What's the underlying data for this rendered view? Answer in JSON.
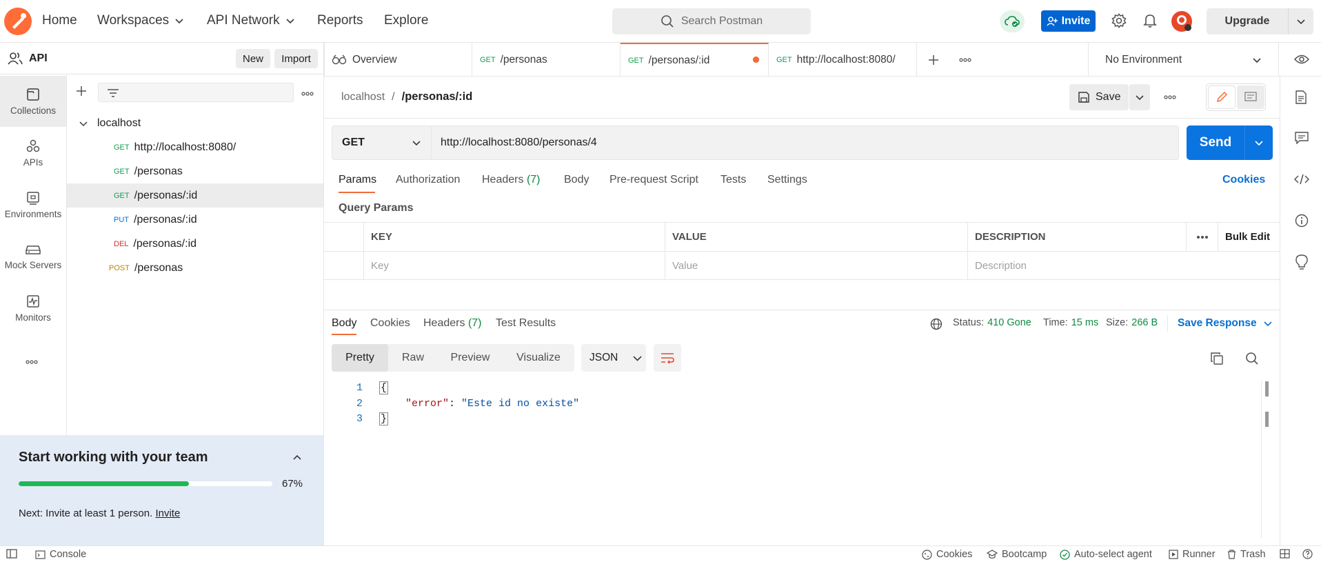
{
  "topnav": {
    "home": "Home",
    "workspaces": "Workspaces",
    "api_network": "API Network",
    "reports": "Reports",
    "explore": "Explore",
    "search_placeholder": "Search Postman",
    "invite": "Invite",
    "upgrade": "Upgrade"
  },
  "workspace": {
    "name": "API",
    "new_btn": "New",
    "import_btn": "Import"
  },
  "rail": [
    {
      "label": "Collections",
      "icon": "collections-icon"
    },
    {
      "label": "APIs",
      "icon": "apis-icon"
    },
    {
      "label": "Environments",
      "icon": "environments-icon"
    },
    {
      "label": "Mock Servers",
      "icon": "mock-servers-icon"
    },
    {
      "label": "Monitors",
      "icon": "monitors-icon"
    }
  ],
  "collection": {
    "name": "localhost",
    "items": [
      {
        "method": "GET",
        "path": "http://localhost:8080/"
      },
      {
        "method": "GET",
        "path": "/personas"
      },
      {
        "method": "GET",
        "path": "/personas/:id"
      },
      {
        "method": "PUT",
        "path": "/personas/:id"
      },
      {
        "method": "DEL",
        "path": "/personas/:id"
      },
      {
        "method": "POST",
        "path": "/personas"
      }
    ]
  },
  "team": {
    "title": "Start working with your team",
    "progress_pct": "67%",
    "progress_value": 0.67,
    "next_text": "Next: Invite at least 1 person.",
    "invite_link": "Invite"
  },
  "tabs": [
    {
      "label": "Overview"
    },
    {
      "method": "GET",
      "label": "/personas"
    },
    {
      "method": "GET",
      "label": "/personas/:id"
    },
    {
      "method": "GET",
      "label": "http://localhost:8080/"
    }
  ],
  "environment": "No Environment",
  "breadcrumb": {
    "parent": "localhost",
    "sep": "/",
    "current": "/personas/:id"
  },
  "save": "Save",
  "request": {
    "method": "GET",
    "url": "http://localhost:8080/personas/4",
    "send": "Send"
  },
  "req_tabs": {
    "params": "Params",
    "authorization": "Authorization",
    "headers": "Headers",
    "headers_count": "(7)",
    "body": "Body",
    "prerequest": "Pre-request Script",
    "tests": "Tests",
    "settings": "Settings",
    "cookies": "Cookies"
  },
  "query_params": {
    "title": "Query Params",
    "col_key": "KEY",
    "col_value": "VALUE",
    "col_description": "DESCRIPTION",
    "bulk_edit": "Bulk Edit",
    "ph_key": "Key",
    "ph_value": "Value",
    "ph_description": "Description"
  },
  "response": {
    "tabs": {
      "body": "Body",
      "cookies": "Cookies",
      "headers": "Headers",
      "headers_count": "(7)",
      "test_results": "Test Results"
    },
    "status_label": "Status:",
    "status_value": "410 Gone",
    "time_label": "Time:",
    "time_value": "15 ms",
    "size_label": "Size:",
    "size_value": "266 B",
    "save_response": "Save Response",
    "views": {
      "pretty": "Pretty",
      "raw": "Raw",
      "preview": "Preview",
      "visualize": "Visualize"
    },
    "format": "JSON",
    "code": {
      "line1_no": "1",
      "line2_no": "2",
      "line3_no": "3",
      "open": "{",
      "key": "\"error\"",
      "colon": ":",
      "value": "\"Este id no existe\"",
      "close": "}"
    }
  },
  "statusbar": {
    "console": "Console",
    "cookies": "Cookies",
    "bootcamp": "Bootcamp",
    "auto_select": "Auto-select agent",
    "runner": "Runner",
    "trash": "Trash"
  },
  "colors": {
    "brand": "#ff6c37",
    "primary": "#0a74e0",
    "status_ok": "#0f8a43"
  }
}
